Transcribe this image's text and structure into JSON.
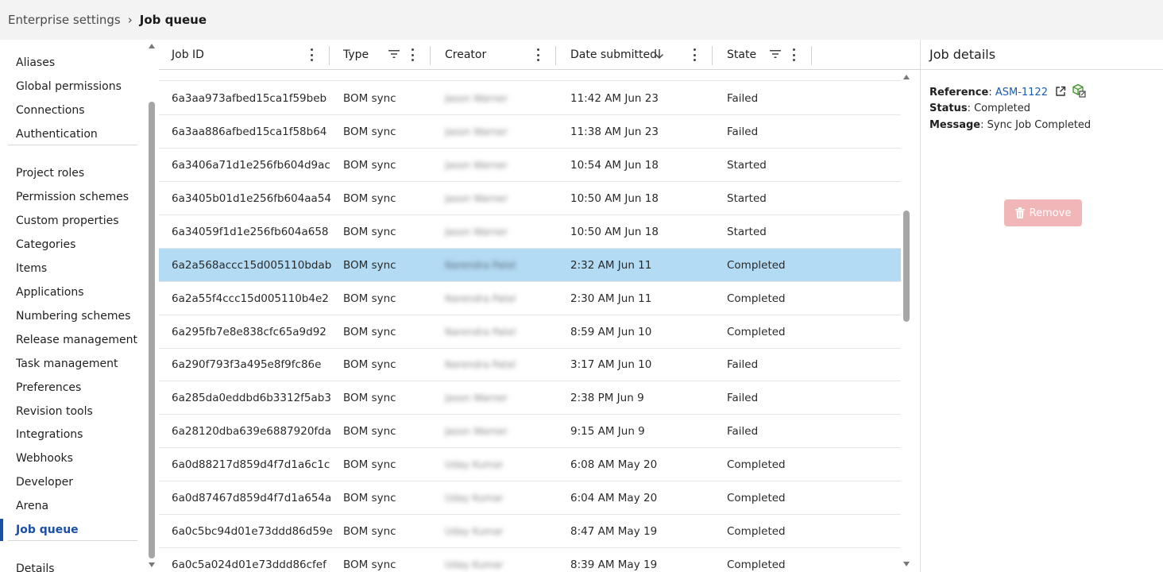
{
  "breadcrumb": {
    "parent": "Enterprise settings",
    "separator": "›",
    "current": "Job queue"
  },
  "sidebar": {
    "groups": [
      [
        "Aliases",
        "Global permissions",
        "Connections",
        "Authentication"
      ],
      [
        "Project roles",
        "Permission schemes",
        "Custom properties",
        "Categories",
        "Items",
        "Applications",
        "Numbering schemes",
        "Release management",
        "Task management",
        "Preferences",
        "Revision tools",
        "Integrations",
        "Webhooks",
        "Developer",
        "Arena",
        "Job queue"
      ],
      [
        "Details"
      ]
    ],
    "active": "Job queue"
  },
  "table": {
    "columns": {
      "job_id": "Job ID",
      "type": "Type",
      "creator": "Creator",
      "date": "Date submitted",
      "state": "State"
    },
    "rows": [
      {
        "id": "6a3aa973afbed15ca1f59beb",
        "type": "BOM sync",
        "creator": "Jason Warner",
        "date": "11:42 AM Jun 23",
        "state": "Failed"
      },
      {
        "id": "6a3aa886afbed15ca1f58b64",
        "type": "BOM sync",
        "creator": "Jason Warner",
        "date": "11:38 AM Jun 23",
        "state": "Failed"
      },
      {
        "id": "6a3406a71d1e256fb604d9ac",
        "type": "BOM sync",
        "creator": "Jason Warner",
        "date": "10:54 AM Jun 18",
        "state": "Started"
      },
      {
        "id": "6a3405b01d1e256fb604aa54",
        "type": "BOM sync",
        "creator": "Jason Warner",
        "date": "10:50 AM Jun 18",
        "state": "Started"
      },
      {
        "id": "6a34059f1d1e256fb604a658",
        "type": "BOM sync",
        "creator": "Jason Warner",
        "date": "10:50 AM Jun 18",
        "state": "Started"
      },
      {
        "id": "6a2a568accc15d005110bdab",
        "type": "BOM sync",
        "creator": "Narendra Patel",
        "date": "2:32 AM Jun 11",
        "state": "Completed",
        "selected": true
      },
      {
        "id": "6a2a55f4ccc15d005110b4e2",
        "type": "BOM sync",
        "creator": "Narendra Patel",
        "date": "2:30 AM Jun 11",
        "state": "Completed"
      },
      {
        "id": "6a295fb7e8e838cfc65a9d92",
        "type": "BOM sync",
        "creator": "Narendra Patel",
        "date": "8:59 AM Jun 10",
        "state": "Completed"
      },
      {
        "id": "6a290f793f3a495e8f9fc86e",
        "type": "BOM sync",
        "creator": "Narendra Patel",
        "date": "3:17 AM Jun 10",
        "state": "Failed"
      },
      {
        "id": "6a285da0eddbd6b3312f5ab3",
        "type": "BOM sync",
        "creator": "Jason Warner",
        "date": "2:38 PM Jun 9",
        "state": "Failed"
      },
      {
        "id": "6a28120dba639e6887920fda",
        "type": "BOM sync",
        "creator": "Jason Warner",
        "date": "9:15 AM Jun 9",
        "state": "Failed"
      },
      {
        "id": "6a0d88217d859d4f7d1a6c1c",
        "type": "BOM sync",
        "creator": "Uday Kumar",
        "date": "6:08 AM May 20",
        "state": "Completed"
      },
      {
        "id": "6a0d87467d859d4f7d1a654a",
        "type": "BOM sync",
        "creator": "Uday Kumar",
        "date": "6:04 AM May 20",
        "state": "Completed"
      },
      {
        "id": "6a0c5bc94d01e73ddd86d59e",
        "type": "BOM sync",
        "creator": "Uday Kumar",
        "date": "8:47 AM May 19",
        "state": "Completed"
      },
      {
        "id": "6a0c5a024d01e73ddd86cfef",
        "type": "BOM sync",
        "creator": "Uday Kumar",
        "date": "8:39 AM May 19",
        "state": "Completed"
      }
    ]
  },
  "details": {
    "title": "Job details",
    "reference_label": "Reference",
    "reference_value": "ASM-1122",
    "status_label": "Status",
    "status_value": "Completed",
    "message_label": "Message",
    "message_value": "Sync Job Completed",
    "remove_label": "Remove"
  },
  "colors": {
    "accent": "#1a4fa8",
    "selected_row": "#b3dbf3",
    "remove_button": "#f1b7b8",
    "link": "#1a5cb0"
  }
}
